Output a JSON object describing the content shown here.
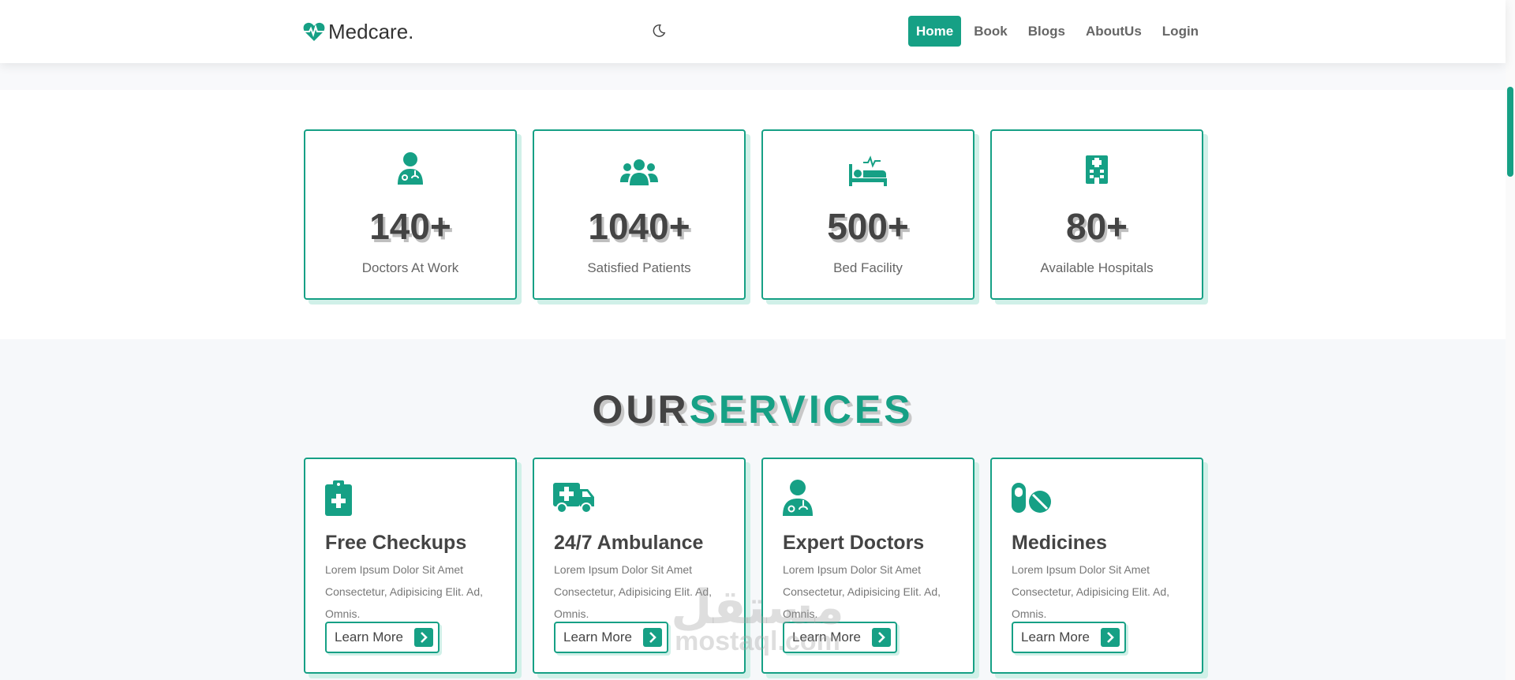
{
  "brand": {
    "name": "Medcare.",
    "accent_color": "#16a085"
  },
  "nav": {
    "items": [
      {
        "label": "Home",
        "active": true
      },
      {
        "label": "Book",
        "active": false
      },
      {
        "label": "Blogs",
        "active": false
      },
      {
        "label": "AboutUs",
        "active": false
      },
      {
        "label": "Login",
        "active": false
      }
    ]
  },
  "theme_toggle": {
    "icon": "moon-icon"
  },
  "stats": [
    {
      "icon": "doctor-icon",
      "value": "140+",
      "label": "Doctors At Work"
    },
    {
      "icon": "users-icon",
      "value": "1040+",
      "label": "Satisfied Patients"
    },
    {
      "icon": "bed-icon",
      "value": "500+",
      "label": "Bed Facility"
    },
    {
      "icon": "hospital-icon",
      "value": "80+",
      "label": "Available Hospitals"
    }
  ],
  "services": {
    "heading_part1": "OUR",
    "heading_part2": "SERVICES",
    "items": [
      {
        "icon": "clipboard-medical-icon",
        "title": "Free Checkups",
        "desc": "Lorem Ipsum Dolor Sit Amet Consectetur, Adipisicing Elit. Ad, Omnis.",
        "button": "Learn More"
      },
      {
        "icon": "ambulance-icon",
        "title": "24/7 Ambulance",
        "desc": "Lorem Ipsum Dolor Sit Amet Consectetur, Adipisicing Elit. Ad, Omnis.",
        "button": "Learn More"
      },
      {
        "icon": "doctor-icon",
        "title": "Expert Doctors",
        "desc": "Lorem Ipsum Dolor Sit Amet Consectetur, Adipisicing Elit. Ad, Omnis.",
        "button": "Learn More"
      },
      {
        "icon": "pills-icon",
        "title": "Medicines",
        "desc": "Lorem Ipsum Dolor Sit Amet Consectetur, Adipisicing Elit. Ad, Omnis.",
        "button": "Learn More"
      }
    ]
  },
  "watermark": {
    "arabic": "مستقل",
    "latin": "mostaql.com"
  }
}
